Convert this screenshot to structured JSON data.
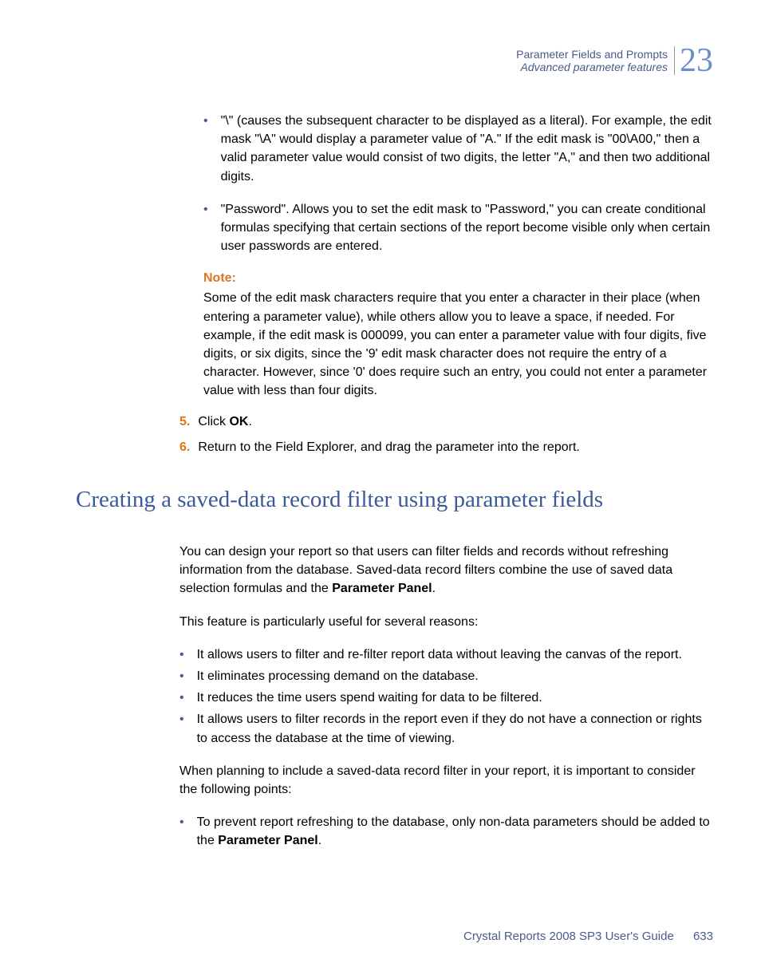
{
  "header": {
    "line1": "Parameter Fields and Prompts",
    "line2": "Advanced parameter features",
    "chapter": "23"
  },
  "bullets": [
    "\"\\\" (causes the subsequent character to be displayed as a literal). For example, the edit mask \"\\A\" would display a parameter value of \"A.\" If the edit mask is \"00\\A00,\" then a valid parameter value would consist of two digits, the letter \"A,\" and then two additional digits.",
    "\"Password\". Allows you to set the edit mask to \"Password,\" you can create conditional formulas specifying that certain sections of the report become visible only when certain user passwords are entered."
  ],
  "note": {
    "label": "Note:",
    "text": "Some of the edit mask characters require that you enter a character in their place (when entering a parameter value), while others allow you to leave a space, if needed. For example, if the edit mask is 000099, you can enter a parameter value with four digits, five digits, or six digits, since the '9' edit mask character does not require the entry of a character. However, since '0' does require such an entry, you could not enter a parameter value with less than four digits."
  },
  "steps": {
    "five": {
      "num": "5.",
      "prefix": "Click ",
      "bold": "OK",
      "suffix": "."
    },
    "six": {
      "num": "6.",
      "text": "Return to the Field Explorer, and drag the parameter into the report."
    }
  },
  "heading": "Creating a saved-data record filter using parameter fields",
  "para1": {
    "prefix": "You can design your report so that users can filter fields and records without refreshing information from the database. Saved-data record filters combine the use of saved data selection formulas and the ",
    "bold": "Parameter Panel",
    "suffix": "."
  },
  "para2": "This feature is particularly useful for several reasons:",
  "features": [
    "It allows users to filter and re-filter report data without leaving the canvas of the report.",
    "It eliminates processing demand on the database.",
    "It reduces the time users spend waiting for data to be filtered.",
    "It allows users to filter records in the report even if they do not have a connection or rights to access the database at the time of viewing."
  ],
  "para3": "When planning to include a saved-data record filter in your report, it is important to consider the following points:",
  "points": {
    "prefix": "To prevent report refreshing to the database, only non-data parameters should be added to the ",
    "bold": "Parameter Panel",
    "suffix": "."
  },
  "footer": {
    "text": "Crystal Reports 2008 SP3 User's Guide",
    "page": "633"
  }
}
